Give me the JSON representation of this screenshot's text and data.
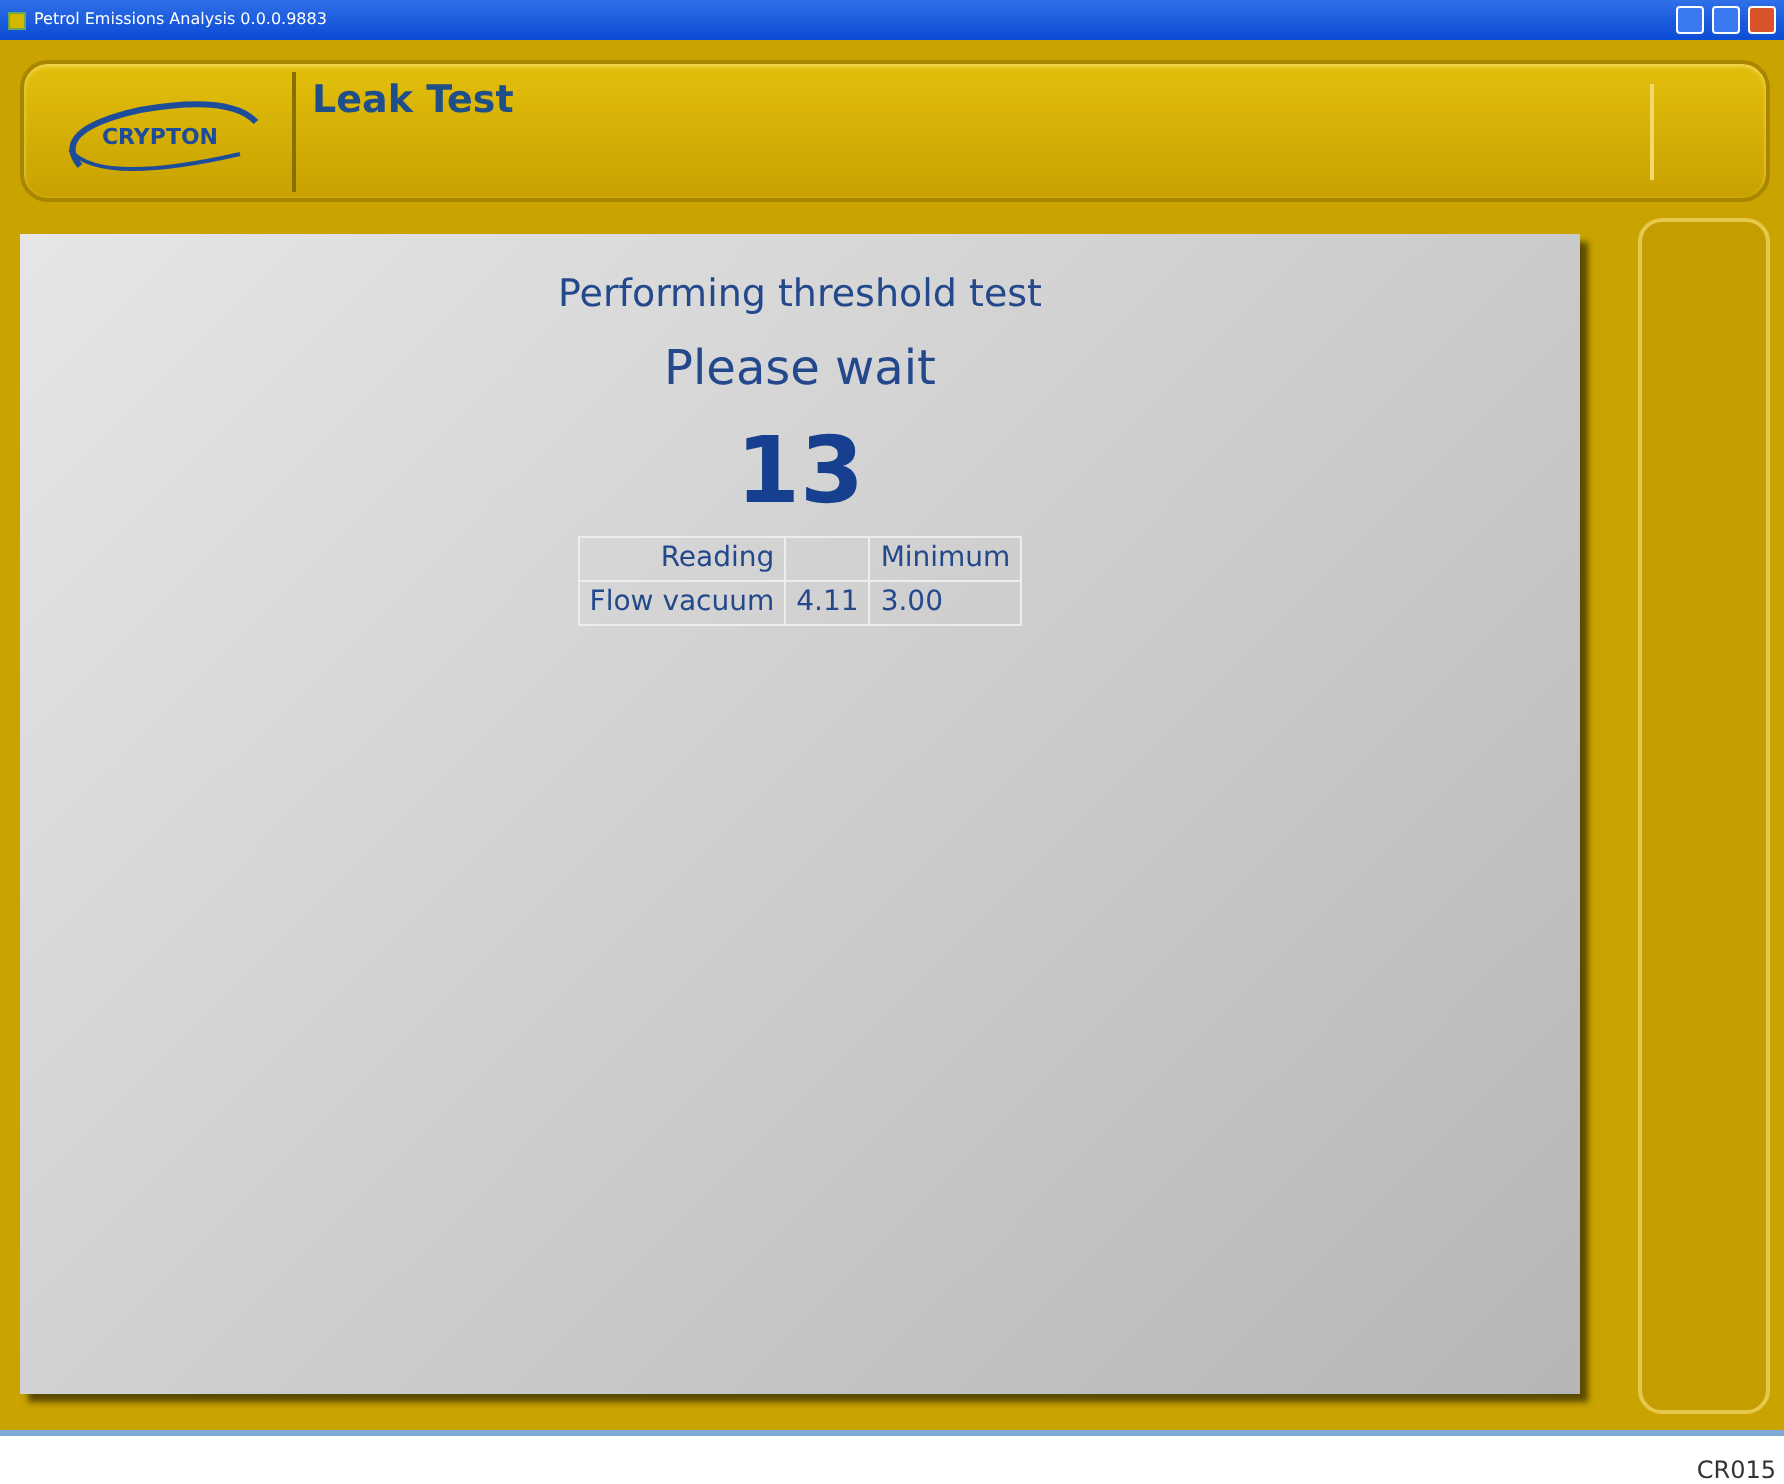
{
  "window": {
    "title": "Petrol Emissions Analysis 0.0.0.9883"
  },
  "header": {
    "logo": "CRYPTON",
    "title": "Leak Test"
  },
  "main": {
    "status": "Performing threshold test",
    "prompt": "Please wait",
    "countdown": "13",
    "table": {
      "columns": [
        "Reading",
        "",
        "Minimum"
      ],
      "rows": [
        [
          "Flow vacuum",
          "4.11",
          "3.00"
        ]
      ]
    }
  },
  "caption": "CR015"
}
